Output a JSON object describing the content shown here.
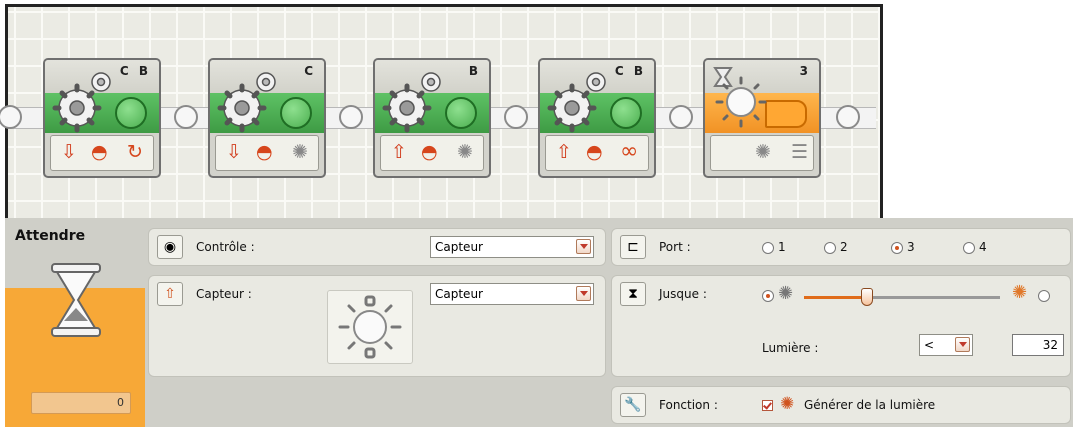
{
  "program": {
    "blocks": [
      {
        "type": "motor",
        "ports": "C B",
        "direction": "down-arrow",
        "power": "speed-dial",
        "mode": "rotation"
      },
      {
        "type": "motor",
        "ports": "C",
        "direction": "down-arrow",
        "power": "speed-dial",
        "mode": "coast"
      },
      {
        "type": "motor",
        "ports": "B",
        "direction": "up-arrow",
        "power": "speed-dial",
        "mode": "coast"
      },
      {
        "type": "motor",
        "ports": "C B",
        "direction": "up-arrow",
        "power": "speed-dial",
        "mode": "unlimited"
      },
      {
        "type": "wait-light",
        "ports": "3",
        "compare": "light-generate",
        "mode": "light-sensor"
      }
    ]
  },
  "panel": {
    "title": "Attendre",
    "counter_value": "0",
    "control": {
      "label": "Contrôle :",
      "value": "Capteur"
    },
    "sensor": {
      "label": "Capteur :",
      "value": "Capteur"
    },
    "port": {
      "label": "Port :",
      "options": [
        "1",
        "2",
        "3",
        "4"
      ],
      "selected": "3"
    },
    "until": {
      "label": "Jusque :",
      "slider_value": 32,
      "slider_max": 100,
      "selected_side": "left"
    },
    "light": {
      "label": "Lumière :",
      "operator": "<",
      "value": "32"
    },
    "function": {
      "label": "Fonction :",
      "checkbox_label": "Générer de la lumière",
      "checked": true
    }
  },
  "colors": {
    "motor_band": "#4caf50",
    "wait_band": "#f7a837",
    "panel_bg": "#cfcfc8",
    "accent": "#d0531e"
  }
}
